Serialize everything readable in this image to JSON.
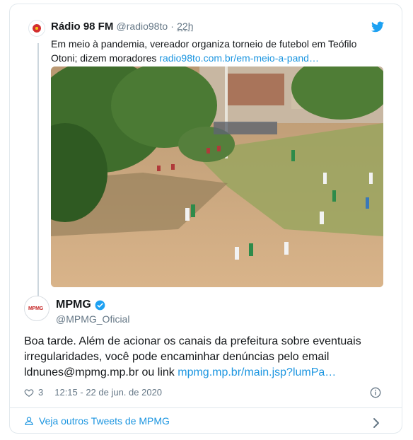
{
  "quoted_tweet": {
    "name": "Rádio 98 FM",
    "handle": "@radio98to",
    "separator": "·",
    "time": "22h",
    "text": "Em meio à pandemia, vereador organiza torneio de futebol em Teófilo Otoni; dizem moradores",
    "link": "radio98to.com.br/em-meio-a-pand…"
  },
  "tweet": {
    "name": "MPMG",
    "handle": "@MPMG_Oficial",
    "text": "Boa tarde. Além de acionar os canais da prefeitura sobre eventuais irregularidades, você pode encaminhar denúncias pelo email ldnunes@mpmg.mp.br ou link",
    "link": "mpmg.mp.br/main.jsp?lumPa…",
    "likes": "3",
    "timestamp": "12:15 - 22 de jun. de 2020"
  },
  "footer": {
    "more_label": "Veja outros Tweets de MPMG"
  },
  "avatar_logo": {
    "red": "MPMG"
  },
  "colors": {
    "link": "#1b95e0",
    "twitter_blue": "#1da1f2",
    "muted": "#657786"
  },
  "icons": [
    "twitter-bird-icon",
    "verified-icon",
    "heart-icon",
    "info-icon",
    "person-icon",
    "chevron-right-icon"
  ]
}
